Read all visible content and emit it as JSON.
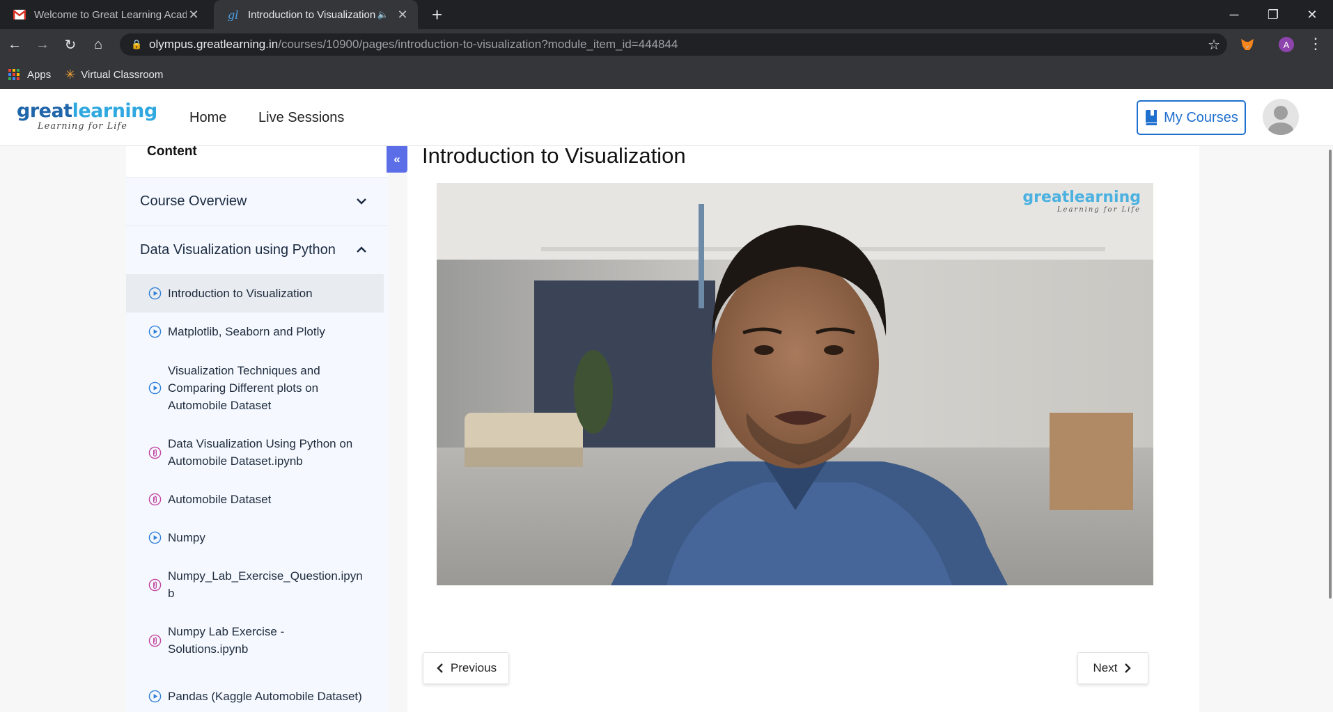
{
  "browser": {
    "tabs": [
      {
        "title": "Welcome to Great Learning Acad",
        "favicon": "gmail-icon"
      },
      {
        "title": "Introduction to Visualization",
        "favicon": "greatlearning-icon",
        "audio": true
      }
    ],
    "url_host": "olympus.greatlearning.in",
    "url_path": "/courses/10900/pages/introduction-to-visualization?module_item_id=444844",
    "profile_letter": "A",
    "bookmarks": [
      "Apps",
      "Virtual Classroom"
    ]
  },
  "site": {
    "logo_great": "great",
    "logo_learning": "learning",
    "logo_tagline": "Learning for Life",
    "nav": [
      "Home",
      "Live Sessions"
    ],
    "my_courses": "My Courses"
  },
  "sidebar": {
    "heading": "Content",
    "sections": [
      {
        "label": "Course Overview",
        "expanded": false
      },
      {
        "label": "Data Visualization using Python",
        "expanded": true
      }
    ],
    "items": [
      {
        "label": "Introduction to Visualization",
        "type": "video",
        "active": true
      },
      {
        "label": "Matplotlib, Seaborn and Plotly",
        "type": "video"
      },
      {
        "label": "Visualization Techniques and Comparing Different plots on Automobile Dataset",
        "type": "video"
      },
      {
        "label": "Data Visualization Using Python on Automobile Dataset.ipynb",
        "type": "attachment"
      },
      {
        "label": "Automobile Dataset",
        "type": "attachment"
      },
      {
        "label": "Numpy",
        "type": "video"
      },
      {
        "label": "Numpy_Lab_Exercise_Question.ipynb",
        "type": "attachment"
      },
      {
        "label": "Numpy Lab Exercise - Solutions.ipynb",
        "type": "attachment"
      },
      {
        "label": "Pandas (Kaggle Automobile Dataset)",
        "type": "video"
      }
    ]
  },
  "main": {
    "title": "Introduction to Visualization",
    "video_watermark": "greatlearning",
    "video_watermark_tag": "Learning for Life",
    "previous": "Previous",
    "next": "Next"
  },
  "colors": {
    "accent": "#1f6fcf",
    "collapse": "#5b6ee8",
    "video_icon": "#2f7fd6",
    "attachment_icon": "#c2459f"
  }
}
